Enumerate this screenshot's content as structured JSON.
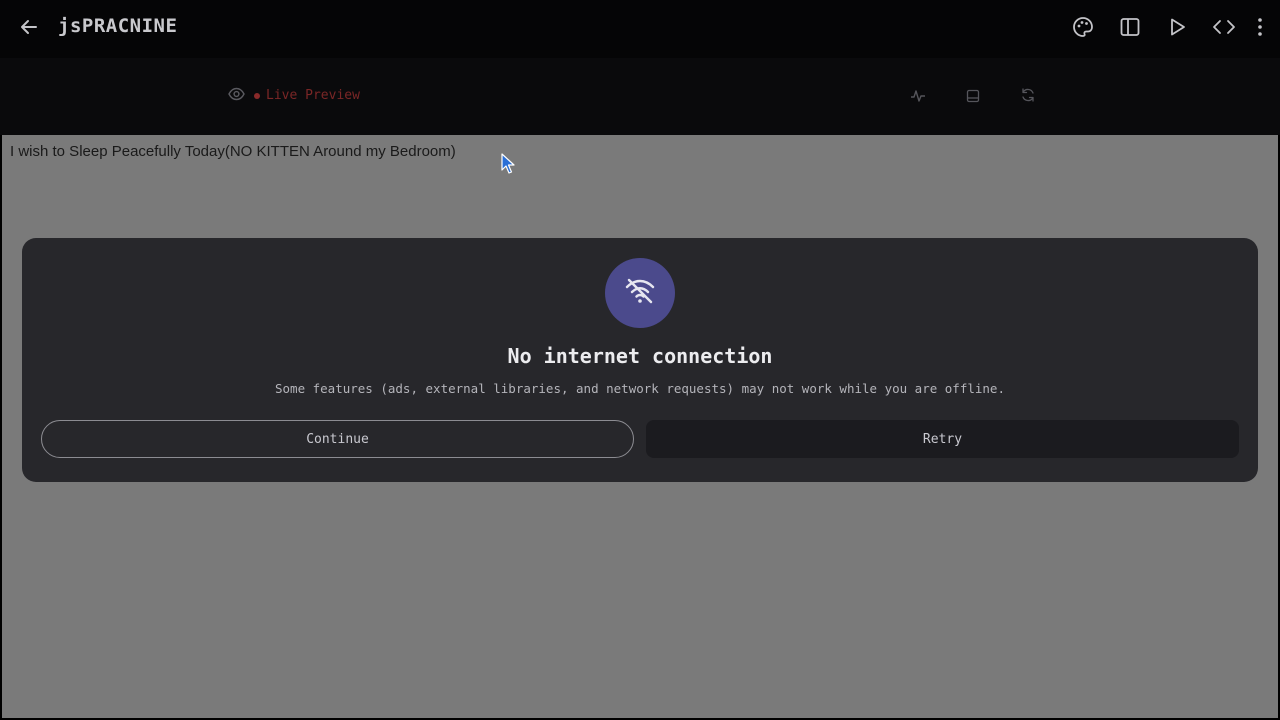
{
  "appbar": {
    "title": "jsPRACNINE",
    "back_icon": "arrow-left-icon",
    "actions": [
      "palette-icon",
      "panel-icon",
      "play-icon",
      "code-icon",
      "more-vert-icon"
    ]
  },
  "preview_bar": {
    "label": "Live Preview",
    "eye_icon": "eye-icon",
    "tools": [
      "activity-icon",
      "layout-icon",
      "refresh-icon"
    ]
  },
  "page": {
    "text": "I wish to Sleep Peacefully Today(NO KITTEN Around my Bedroom)"
  },
  "dialog": {
    "icon": "wifi-off-icon",
    "title": "No internet connection",
    "message": "Some features (ads, external libraries, and network requests) may not work while you are offline.",
    "continue_label": "Continue",
    "retry_label": "Retry"
  },
  "colors": {
    "accent": "#4b4a8c",
    "live": "#7a2626",
    "dialog_bg": "#27272b",
    "overlay": "#7a7a7a"
  }
}
